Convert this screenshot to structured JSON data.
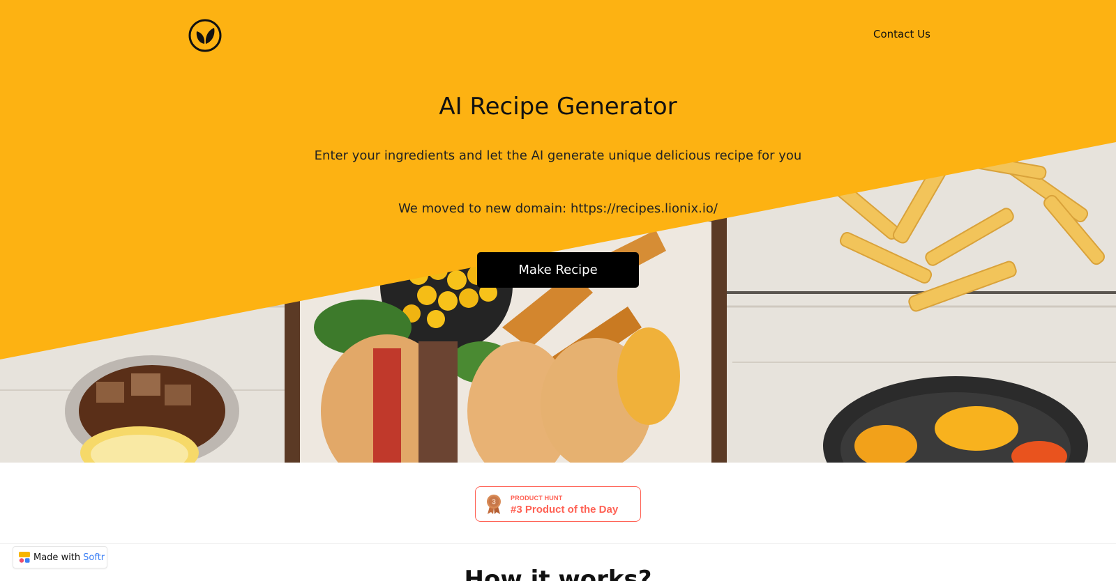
{
  "header": {
    "logo_icon": "leaf-circle-icon",
    "contact_label": "Contact Us"
  },
  "hero": {
    "title": "AI Recipe Generator",
    "subtitle": "Enter your ingredients and let the AI generate unique delicious recipe for you",
    "domain_notice": "We moved to new domain: https://recipes.lionix.io/",
    "cta_label": "Make Recipe",
    "accent_color": "#fdb212"
  },
  "badge": {
    "label_small": "PRODUCT HUNT",
    "label_big": "#3 Product of the Day",
    "medal_number": "3",
    "color": "#ff6154"
  },
  "section": {
    "title": "How it works?"
  },
  "footer_badge": {
    "prefix": "Made with",
    "brand": "Softr",
    "brand_color": "#3b7ff5"
  }
}
